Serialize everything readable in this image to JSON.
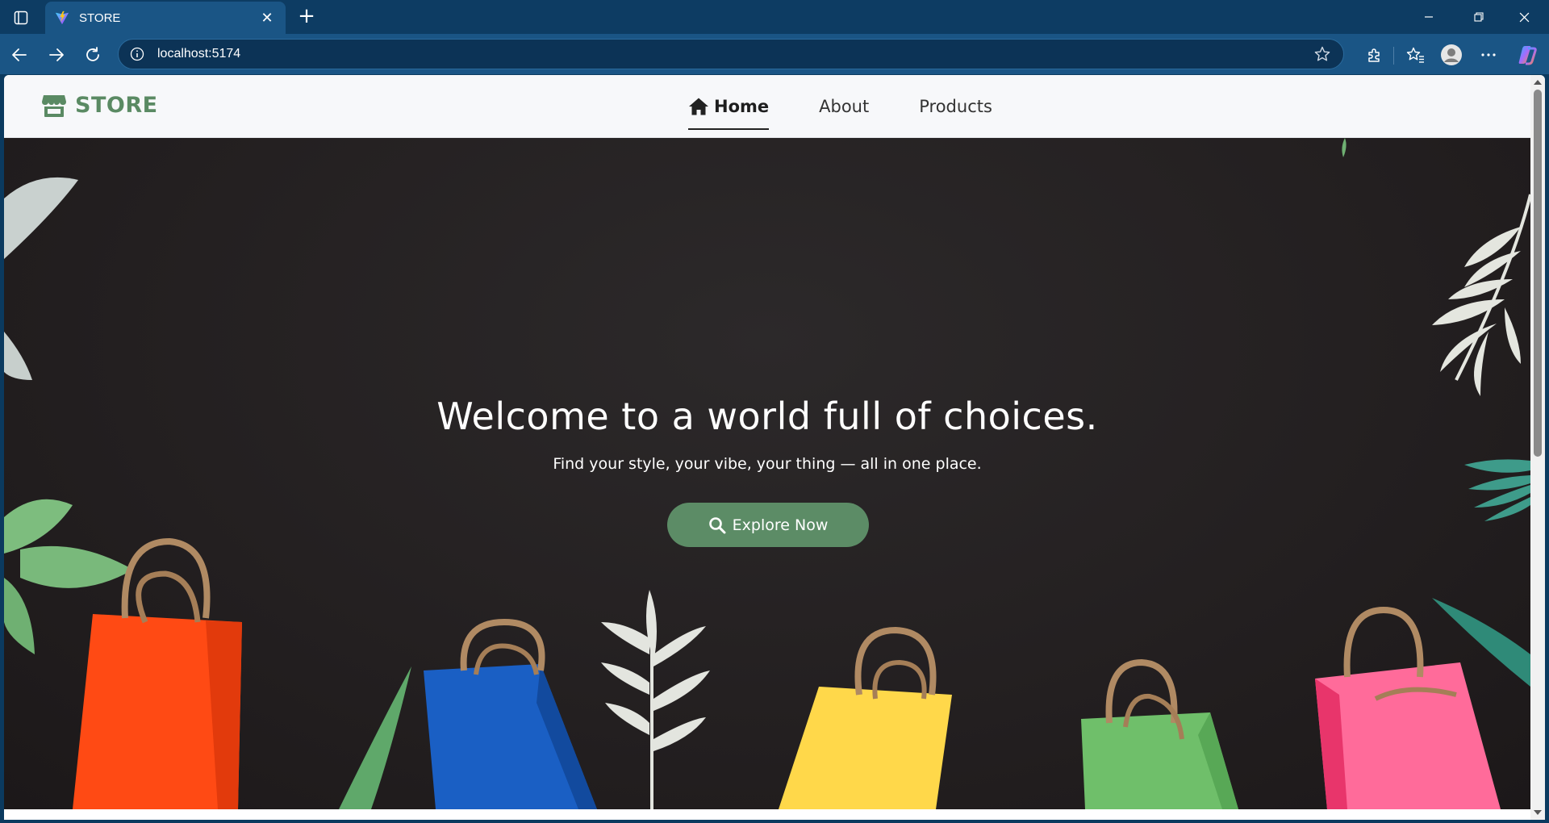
{
  "browser": {
    "tab": {
      "title": "STORE",
      "favicon": "vite-icon"
    },
    "address": {
      "url": "localhost:5174"
    },
    "colors": {
      "frame": "#0d3c63",
      "toolbar": "#1a5585"
    }
  },
  "site": {
    "brand": {
      "name": "STORE",
      "icon": "store-icon",
      "color": "#5a8a63"
    },
    "nav": {
      "home": "Home",
      "about": "About",
      "products": "Products"
    },
    "hero": {
      "title": "Welcome to a world full of choices.",
      "subtitle": "Find your style, your vibe, your thing — all in one place.",
      "cta": "Explore Now",
      "cta_icon": "search-icon",
      "cta_color": "#5c8c66"
    }
  }
}
